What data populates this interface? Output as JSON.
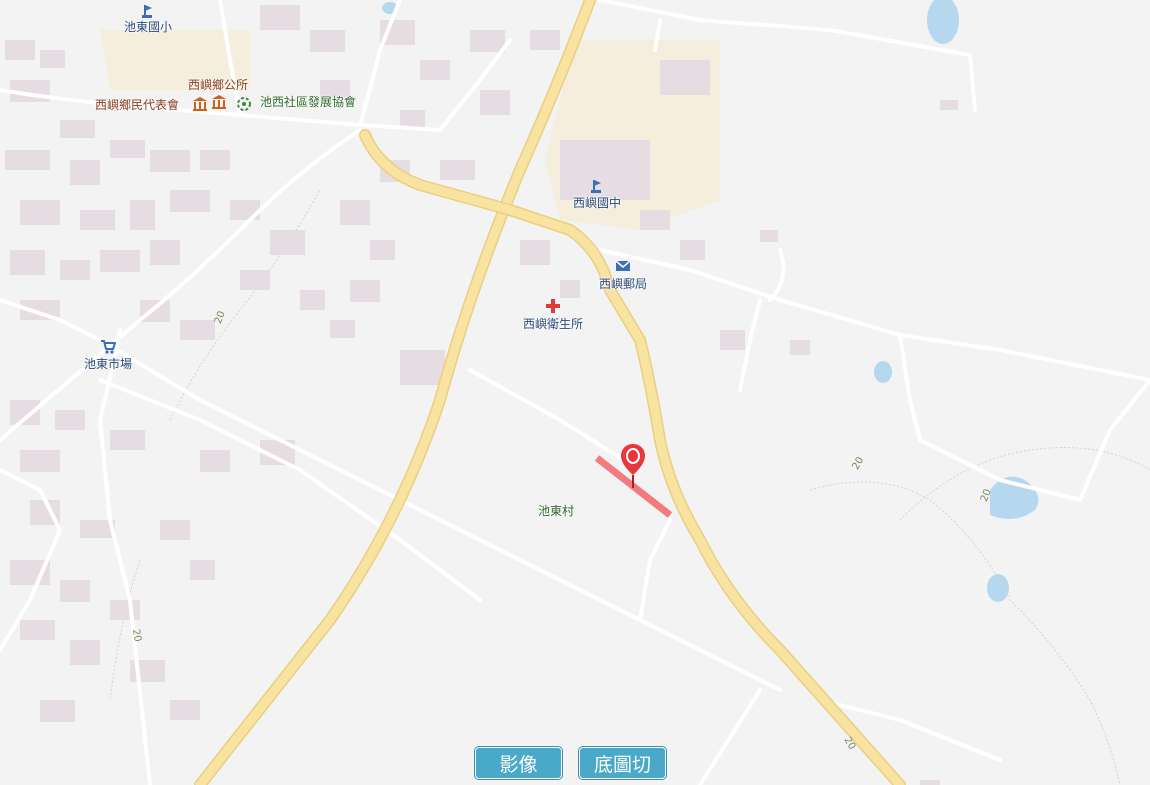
{
  "map": {
    "labels": {
      "chidong_elementary": "池東國小",
      "xiyu_township_office": "西嶼鄉公所",
      "xiyu_council": "西嶼鄉民代表會",
      "chixi_community": "池西社區發展協會",
      "xiyu_junior_high": "西嶼國中",
      "xiyu_post_office": "西嶼郵局",
      "xiyu_health_center": "西嶼衛生所",
      "chidong_market": "池東市場",
      "chidong_village": "池東村"
    },
    "road_numbers": [
      "20",
      "20",
      "20",
      "20",
      "20"
    ],
    "colors": {
      "background": "#f3f3f4",
      "main_road": "#f9e3a0",
      "main_road_casing": "#e9cf80",
      "minor_road": "#ffffff",
      "building": "#e6dde3",
      "school_area": "#f5eedd",
      "water": "#b6d8ef",
      "marker": "#e8383d",
      "highlight_segment": "#f07c80",
      "button": "#4aa9c8"
    }
  },
  "controls": {
    "image_button": "影像",
    "basemap_switch_button": "底圖切換"
  }
}
